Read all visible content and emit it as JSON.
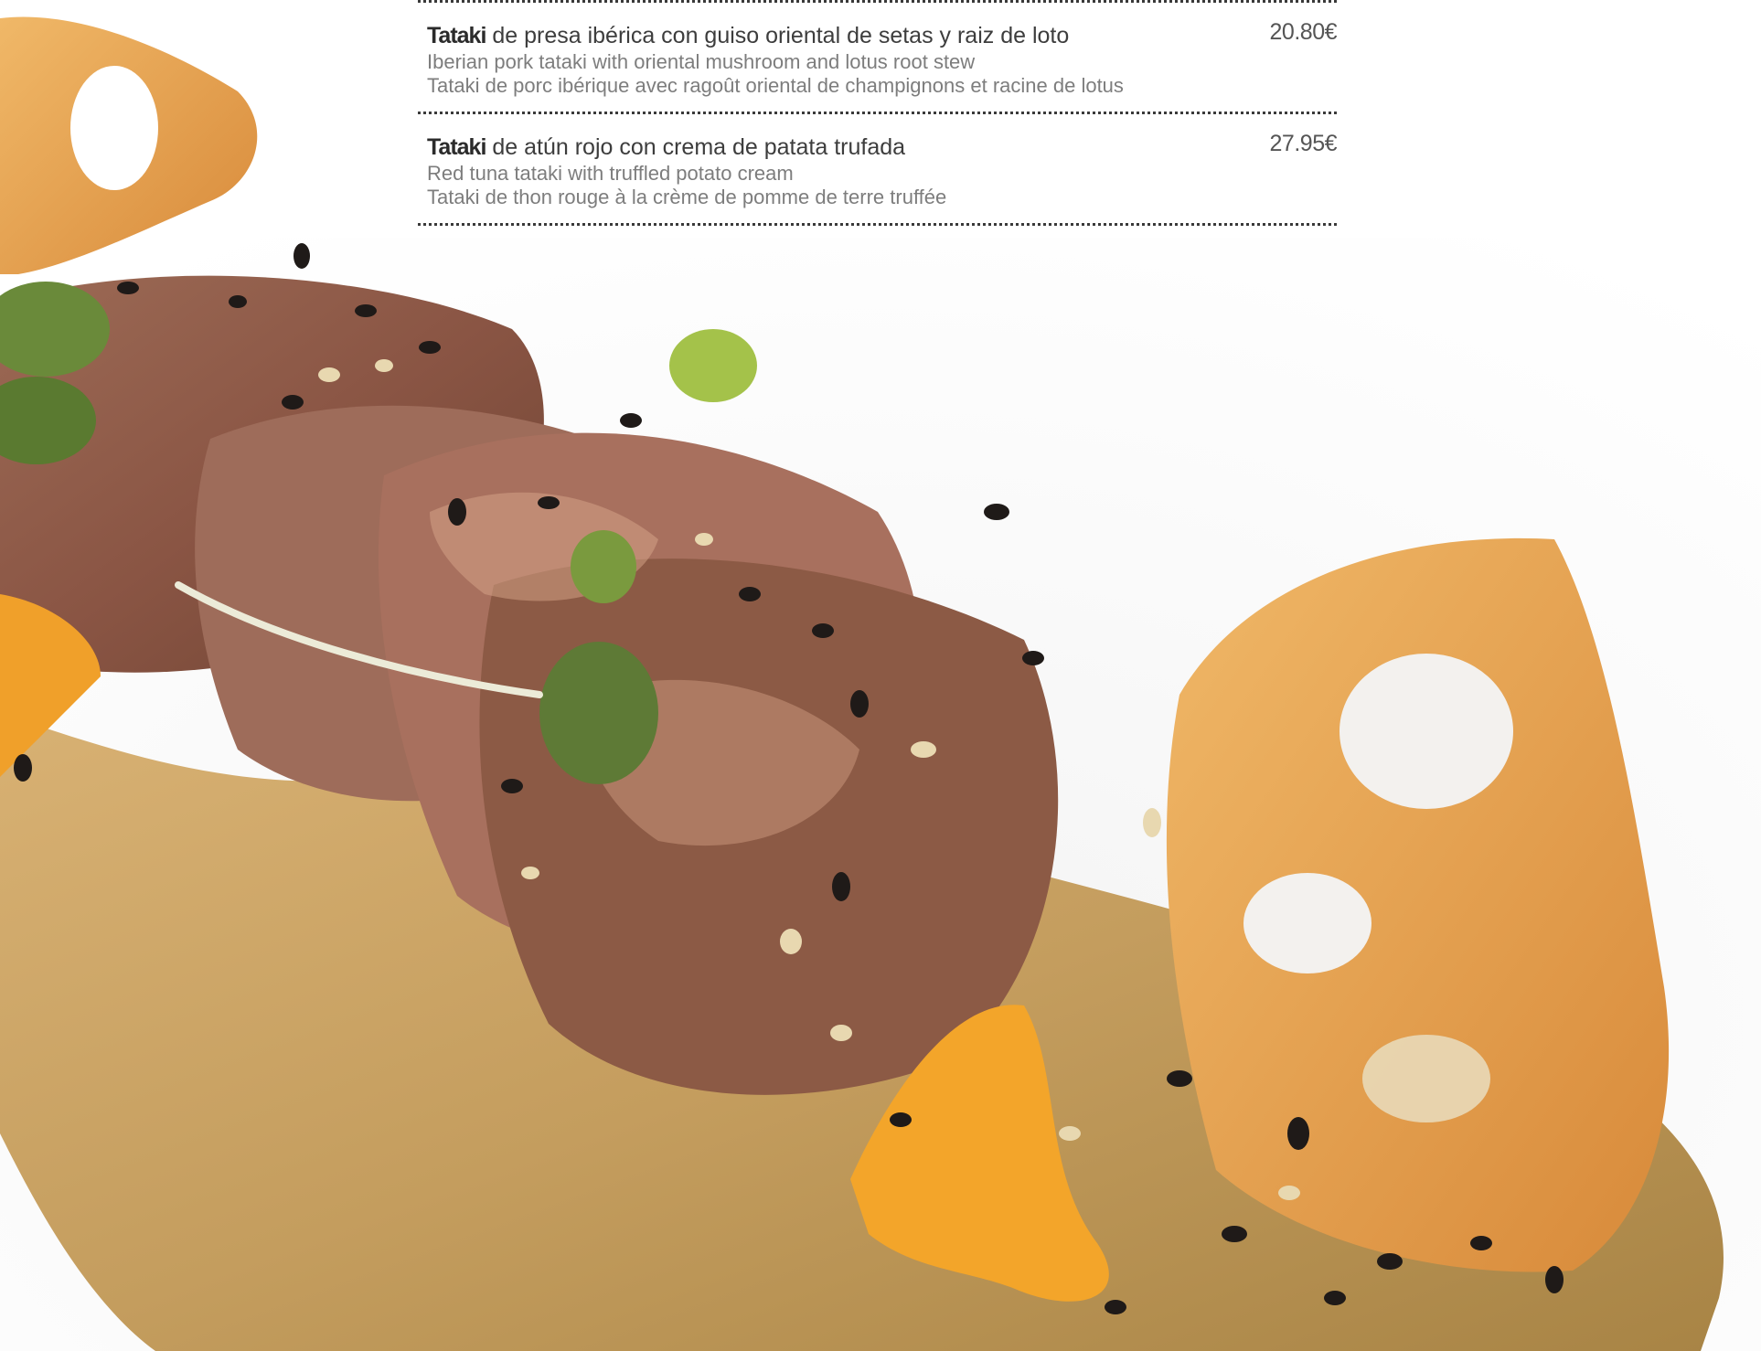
{
  "menu": {
    "items": [
      {
        "name_bold": "Tataki",
        "name_rest": " de presa ibérica con guiso oriental de setas y raiz de loto",
        "english": "Iberian pork tataki with oriental mushroom and lotus root stew",
        "french": "Tataki de porc ibérique avec ragoût oriental de champignons et racine de lotus",
        "price": "20.80€"
      },
      {
        "name_bold": "Tataki",
        "name_rest": " de atún rojo con crema de patata trufada",
        "english": "Red tuna tataki with truffled potato cream",
        "french": "Tataki de thon rouge à la crème de pomme de terre truffée",
        "price": "27.95€"
      }
    ]
  },
  "colors": {
    "text_dark": "#2b2b2b",
    "text_grey": "#7d7d7d",
    "sauce": "#c9a160",
    "meat": "#8a5a46",
    "lotus": "#e6a457"
  }
}
